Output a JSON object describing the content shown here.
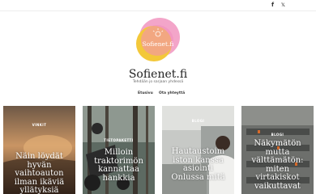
{
  "header": {
    "social": [
      {
        "name": "facebook-icon",
        "glyph": "f"
      },
      {
        "name": "twitter-icon",
        "glyph": "𝕏"
      }
    ]
  },
  "brand": {
    "logo_text": "Sofienet.fi",
    "title": "Sofienet.fi",
    "tagline": "Tehdään jo sarjaan yhdessä",
    "colors": {
      "pink": "#f3a5c9",
      "yellow": "#f3c83a",
      "text_on_logo": "#ffffff"
    }
  },
  "nav": {
    "items": [
      "Etusivu",
      "Ota yhteyttä"
    ]
  },
  "cards": [
    {
      "category": "VINKIT",
      "title": "Näin löydät hyvän vaihtoauton ilman ikäviä yllätyksiä"
    },
    {
      "category": "TIETOPAKETTI",
      "title": "Milloin traktorimön kannattaa hankkia"
    },
    {
      "category": "BLOGI",
      "title": "Hautaustoim iston kanssa asiointi Onlussa mitä"
    },
    {
      "category": "BLOGI",
      "title": "Näkymätön mutta välttämätön: miten virtakiskot vaikuttavat"
    }
  ]
}
